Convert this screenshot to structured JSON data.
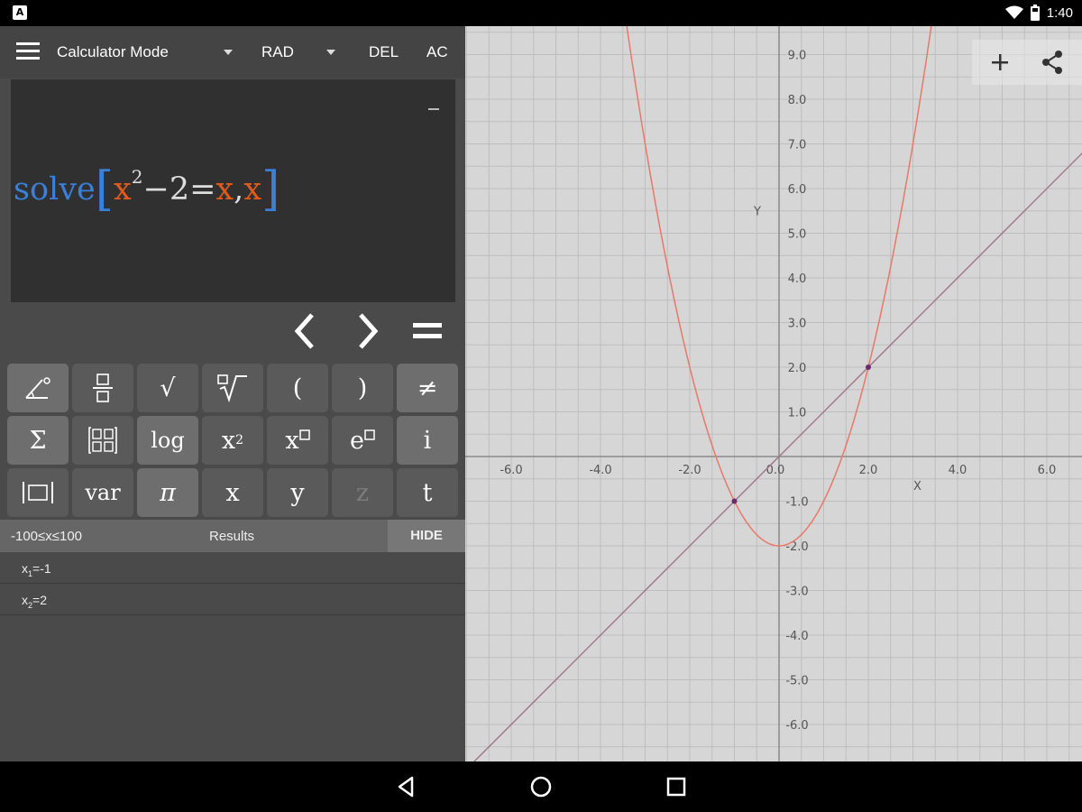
{
  "status_bar": {
    "time": "1:40",
    "icons": [
      "notification-icon",
      "wifi-icon",
      "battery-icon"
    ]
  },
  "toolbar": {
    "mode_label": "Calculator Mode",
    "angle_label": "RAD",
    "del_label": "DEL",
    "ac_label": "AC"
  },
  "expression": {
    "func": "solve",
    "var1": "x",
    "exponent": "2",
    "middle": "−2=",
    "var2": "x",
    "comma": ",",
    "var3": "x"
  },
  "nav": {
    "left": "cursor-left",
    "right": "cursor-right",
    "equals": "equals"
  },
  "keypad": {
    "rows": [
      [
        "∠°",
        "▯/▯",
        "√",
        "▯√",
        "(",
        ")",
        "≠"
      ],
      [
        "Σ",
        "⊞",
        "log",
        "x²",
        "x▯",
        "e▯",
        "i"
      ],
      [
        "|▯|",
        "var",
        "π",
        "x",
        "y",
        "z",
        "t"
      ]
    ],
    "labels": {
      "log": "log",
      "var": "var",
      "open_paren": "(",
      "close_paren": ")",
      "neq": "≠",
      "sigma": "Σ",
      "sqrt": "√",
      "pi": "π",
      "x": "x",
      "y": "y",
      "z": "z",
      "t": "t",
      "i": "i",
      "x_base": "x",
      "x_sq_exp": "2",
      "e_base": "e"
    }
  },
  "results": {
    "range": "-100≤x≤100",
    "title": "Results",
    "hide_label": "HIDE",
    "items": [
      {
        "name": "x",
        "sub": "1",
        "value": "=-1"
      },
      {
        "name": "x",
        "sub": "2",
        "value": "=2"
      }
    ]
  },
  "graph": {
    "x_axis_label": "X",
    "y_axis_label": "Y",
    "x_ticks": [
      "-6.0",
      "-4.0",
      "-2.0",
      "0.0",
      "2.0",
      "4.0",
      "6.0"
    ],
    "y_ticks": [
      "9.0",
      "8.0",
      "7.0",
      "6.0",
      "5.0",
      "4.0",
      "3.0",
      "2.0",
      "1.0",
      "-1.0",
      "-2.0",
      "-3.0",
      "-4.0",
      "-5.0",
      "-6.0"
    ],
    "colors": {
      "background": "#d6d6d6",
      "grid": "#bdbdbd",
      "axis": "#8a8a8a",
      "parabola": "#e8786a",
      "line": "#a07890",
      "point": "#6a2a6a"
    },
    "functions": [
      "x^2-2",
      "x"
    ],
    "intersections": [
      [
        -1,
        -1
      ],
      [
        2,
        2
      ]
    ],
    "x_range": [
      -7,
      7
    ],
    "y_range": [
      -6.8,
      9.8
    ]
  },
  "graph_actions": {
    "add": "plus-icon",
    "share": "share-icon"
  }
}
